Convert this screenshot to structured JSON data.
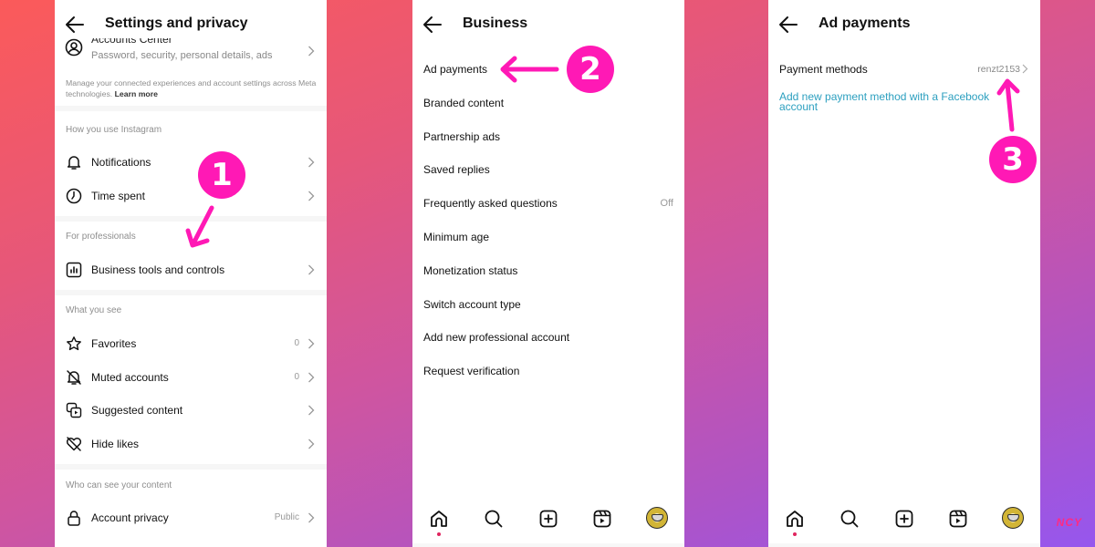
{
  "colors": {
    "accent_annotation": "#ff19b5",
    "link": "#2b9fbf",
    "secondary_text": "#8e8e8e",
    "notification_dot": "#e0245e"
  },
  "screen1": {
    "title": "Settings and privacy",
    "accounts_center": {
      "title": "Accounts Center",
      "subtitle": "Password, security, personal details, ads",
      "icon": "person-circle-icon"
    },
    "meta_note": "Manage your connected experiences and account settings across Meta technologies.",
    "learn_more": "Learn more",
    "sections": [
      {
        "header": "How you use Instagram",
        "items": [
          {
            "label": "Notifications",
            "icon": "bell-icon",
            "value": ""
          },
          {
            "label": "Time spent",
            "icon": "clock-icon",
            "value": ""
          }
        ]
      },
      {
        "header": "For professionals",
        "items": [
          {
            "label": "Business tools and controls",
            "icon": "bar-chart-icon",
            "value": ""
          }
        ]
      },
      {
        "header": "What you see",
        "items": [
          {
            "label": "Favorites",
            "icon": "star-icon",
            "value": "0"
          },
          {
            "label": "Muted accounts",
            "icon": "bell-off-icon",
            "value": "0"
          },
          {
            "label": "Suggested content",
            "icon": "suggested-content-icon",
            "value": ""
          },
          {
            "label": "Hide likes",
            "icon": "heart-off-icon",
            "value": ""
          }
        ]
      },
      {
        "header": "Who can see your content",
        "items": [
          {
            "label": "Account privacy",
            "icon": "lock-icon",
            "value": "Public"
          }
        ]
      }
    ]
  },
  "screen2": {
    "title": "Business",
    "items": [
      {
        "label": "Ad payments",
        "value": ""
      },
      {
        "label": "Branded content",
        "value": ""
      },
      {
        "label": "Partnership ads",
        "value": ""
      },
      {
        "label": "Saved replies",
        "value": ""
      },
      {
        "label": "Frequently asked questions",
        "value": "Off"
      },
      {
        "label": "Minimum age",
        "value": ""
      },
      {
        "label": "Monetization status",
        "value": ""
      },
      {
        "label": "Switch account type",
        "value": ""
      },
      {
        "label": "Add new professional account",
        "value": ""
      },
      {
        "label": "Request verification",
        "value": ""
      }
    ]
  },
  "screen3": {
    "title": "Ad payments",
    "payment_methods_label": "Payment methods",
    "payment_methods_value": "renzt2153",
    "facebook_link": "Add new payment method with a Facebook account"
  },
  "bottom_nav": [
    {
      "name": "home",
      "icon": "home-icon"
    },
    {
      "name": "search",
      "icon": "search-icon"
    },
    {
      "name": "create",
      "icon": "plus-square-icon"
    },
    {
      "name": "reels",
      "icon": "reels-icon"
    },
    {
      "name": "profile",
      "icon": "avatar"
    }
  ],
  "annotations": {
    "step1": "1",
    "step2": "2",
    "step3": "3"
  },
  "watermark": "NCY"
}
